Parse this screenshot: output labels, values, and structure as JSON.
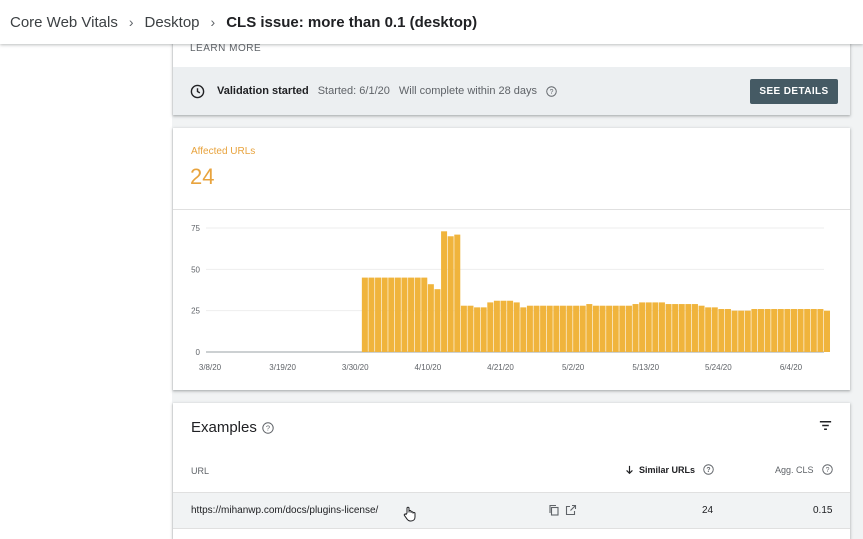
{
  "breadcrumb": {
    "items": [
      "Core Web Vitals",
      "Desktop"
    ],
    "current": "CLS issue: more than 0.1 (desktop)"
  },
  "validation": {
    "learn_more": "LEARN MORE",
    "title": "Validation started",
    "started": "Started: 6/1/20",
    "complete": "Will complete within 28 days",
    "button": "SEE DETAILS"
  },
  "affected": {
    "label": "Affected URLs",
    "value": "24",
    "color": "#f0b43c"
  },
  "chart_data": {
    "type": "bar",
    "title": "",
    "xlabel": "",
    "ylabel": "",
    "ylim": [
      0,
      75
    ],
    "yticks": [
      0,
      25,
      50,
      75
    ],
    "xticks": [
      "3/8/20",
      "3/19/20",
      "3/30/20",
      "4/10/20",
      "4/21/20",
      "5/2/20",
      "5/13/20",
      "5/24/20",
      "6/4/20"
    ],
    "grid": true,
    "series_start": "3/8/20",
    "values": [
      0,
      0,
      0,
      0,
      0,
      0,
      0,
      0,
      0,
      0,
      0,
      0,
      0,
      0,
      0,
      0,
      0,
      0,
      0,
      0,
      0,
      0,
      0,
      45,
      45,
      45,
      45,
      45,
      45,
      45,
      45,
      45,
      45,
      41,
      38,
      73,
      70,
      71,
      28,
      28,
      27,
      27,
      30,
      31,
      31,
      31,
      30,
      27,
      28,
      28,
      28,
      28,
      28,
      28,
      28,
      28,
      28,
      29,
      28,
      28,
      28,
      28,
      28,
      28,
      29,
      30,
      30,
      30,
      30,
      29,
      29,
      29,
      29,
      29,
      28,
      27,
      27,
      26,
      26,
      25,
      25,
      25,
      26,
      26,
      26,
      26,
      26,
      26,
      26,
      26,
      26,
      26,
      26,
      25
    ]
  },
  "examples": {
    "title": "Examples",
    "columns": {
      "url": "URL",
      "similar": "Similar URLs",
      "agg": "Agg. CLS"
    },
    "rows": [
      {
        "url": "https://mihanwp.com/docs/plugins-license/",
        "similar": "24",
        "agg": "0.15"
      }
    ]
  }
}
